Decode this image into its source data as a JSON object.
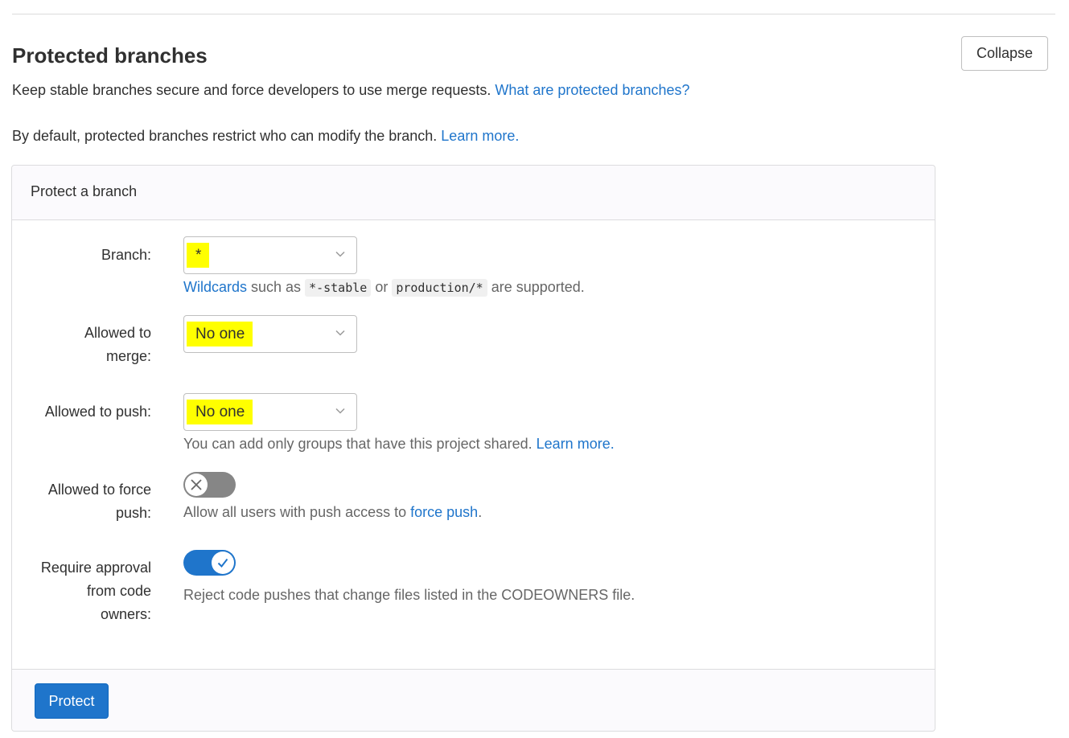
{
  "header": {
    "title": "Protected branches",
    "collapse_label": "Collapse",
    "description": "Keep stable branches secure and force developers to use merge requests.",
    "description_link": "What are protected branches?",
    "default_text": "By default, protected branches restrict who can modify the branch.",
    "default_link": "Learn more."
  },
  "panel": {
    "title": "Protect a branch",
    "branch": {
      "label": "Branch:",
      "value": "*",
      "help_link": "Wildcards",
      "help_text_1": " such as ",
      "code_1": "*-stable",
      "help_text_2": " or ",
      "code_2": "production/*",
      "help_text_3": " are supported."
    },
    "merge": {
      "label_line1": "Allowed to",
      "label_line2": "merge:",
      "value": "No one"
    },
    "push": {
      "label": "Allowed to push:",
      "value": "No one",
      "help_text": "You can add only groups that have this project shared.",
      "help_link": "Learn more."
    },
    "force_push": {
      "label_line1": "Allowed to force",
      "label_line2": "push:",
      "enabled": false,
      "help_text": "Allow all users with push access to",
      "help_link": "force push",
      "help_suffix": "."
    },
    "code_owners": {
      "label_line1": "Require approval",
      "label_line2": "from code",
      "label_line3": "owners:",
      "enabled": true,
      "help_text": "Reject code pushes that change files listed in the CODEOWNERS file."
    },
    "protect_label": "Protect"
  },
  "colors": {
    "link": "#1f75cb",
    "primary_button": "#1f75cb",
    "highlight": "#ffff00",
    "toggle_off": "#868686",
    "toggle_on": "#1f75cb"
  },
  "icons": {
    "select_chevron": "chevron-down-icon",
    "toggle_off": "close-icon",
    "toggle_on": "check-icon"
  }
}
